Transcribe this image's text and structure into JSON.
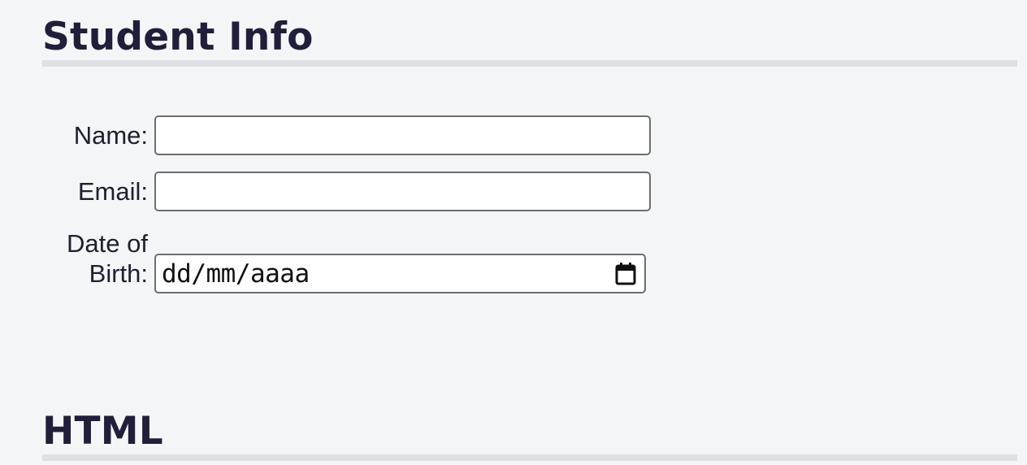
{
  "sections": {
    "student_info_title": "Student Info",
    "html_title": "HTML"
  },
  "form": {
    "name_label": "Name:",
    "name_value": "",
    "email_label": "Email:",
    "email_value": "",
    "dob_label_line1": "Date of",
    "dob_label_line2": "Birth:",
    "dob_placeholder": "dd/mm/aaaa"
  },
  "icons": {
    "date_picker": "calendar-icon"
  }
}
